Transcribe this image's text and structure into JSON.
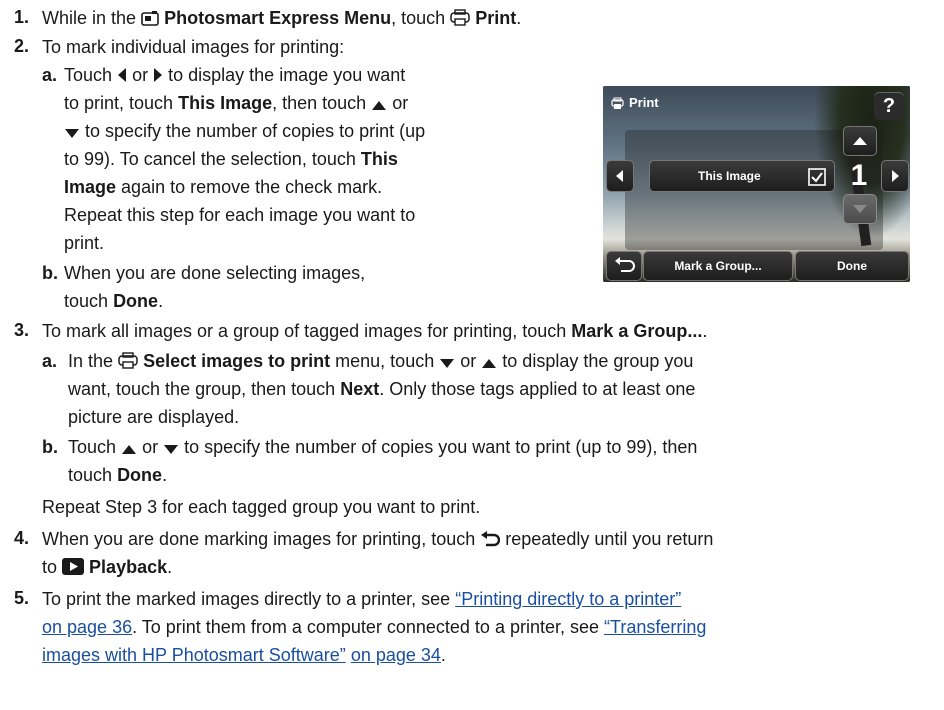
{
  "steps": [
    {
      "number": "1.",
      "text_a": "While in the",
      "menu_name": "Photosmart Express Menu",
      "text_b": ", touch",
      "print_label": "Print",
      "text_c": "."
    },
    {
      "number": "2.",
      "intro": "To mark individual images for printing:",
      "sub_a": {
        "letter": "a",
        "line1_a": "Touch",
        "line1_b": "or",
        "line1_c": "to display the image you want",
        "line2_a": "to print, touch",
        "line2_bold": "This Image",
        "line2_b": ", then touch",
        "line2_c": "or",
        "line3": "to specify the number of copies to print (up",
        "line4": "to 99). To cancel the selection, touch",
        "line4_bold": "This",
        "line5_bold": "Image",
        "line5": "again to remove the check mark.",
        "line6": "Repeat this step for each image you want to",
        "line7": "print."
      },
      "sub_b": {
        "letter": "b",
        "line1": "When you are done selecting images,",
        "line2_a": "touch",
        "line2_bold": "Done",
        "line2_b": "."
      }
    },
    {
      "number": "3.",
      "intro_a": "To mark all images or a group of tagged images for printing, touch",
      "intro_bold": "Mark a Group...",
      "intro_b": ".",
      "sub_a": {
        "letter": "a",
        "line1_a": "In the",
        "line1_bold": "Select images to print",
        "line1_b": "menu, touch",
        "line1_c": "or",
        "line1_d": "to display the group you",
        "line2_a": "want, touch the group, then touch",
        "line2_bold": "Next",
        "line2_b": ". Only those tags applied to at least one",
        "line3": "picture are displayed."
      },
      "sub_b": {
        "letter": "b",
        "line1_a": "Touch",
        "line1_b": "or",
        "line1_c": "to specify the number of copies you want to print (up to 99), then",
        "line2_a": "touch",
        "line2_bold": "Done",
        "line2_b": "."
      },
      "repeat": "Repeat Step 3 for each tagged group you want to print."
    },
    {
      "number": "4.",
      "line1_a": "When you are done marking images for printing, touch",
      "line1_b": "repeatedly until you return",
      "line2_a": "to",
      "line2_bold": "Playback",
      "line2_b": "."
    },
    {
      "number": "5.",
      "line1_a": "To print the marked images directly to a printer, see",
      "link1_a": "“Printing directly to a printer”",
      "link1_b": "on page 36",
      "line2_b": ". To print them from a computer connected to a printer, see",
      "link2_a": "“Transferring",
      "link2_b": "images with HP Photosmart Software”",
      "link2_c": "on page 34",
      "line3_b": "."
    }
  ],
  "camera_screen": {
    "title": "Print",
    "help_label": "?",
    "this_image_label": "This Image",
    "copies": "1",
    "mark_group_label": "Mark a Group...",
    "done_label": "Done",
    "icons": [
      "print-icon",
      "help-icon",
      "up-arrow-icon",
      "down-arrow-icon",
      "left-arrow-icon",
      "right-arrow-icon",
      "checkbox-icon",
      "back-icon"
    ]
  },
  "colors": {
    "link": "#1a4fa0",
    "text": "#1a1a1a"
  }
}
